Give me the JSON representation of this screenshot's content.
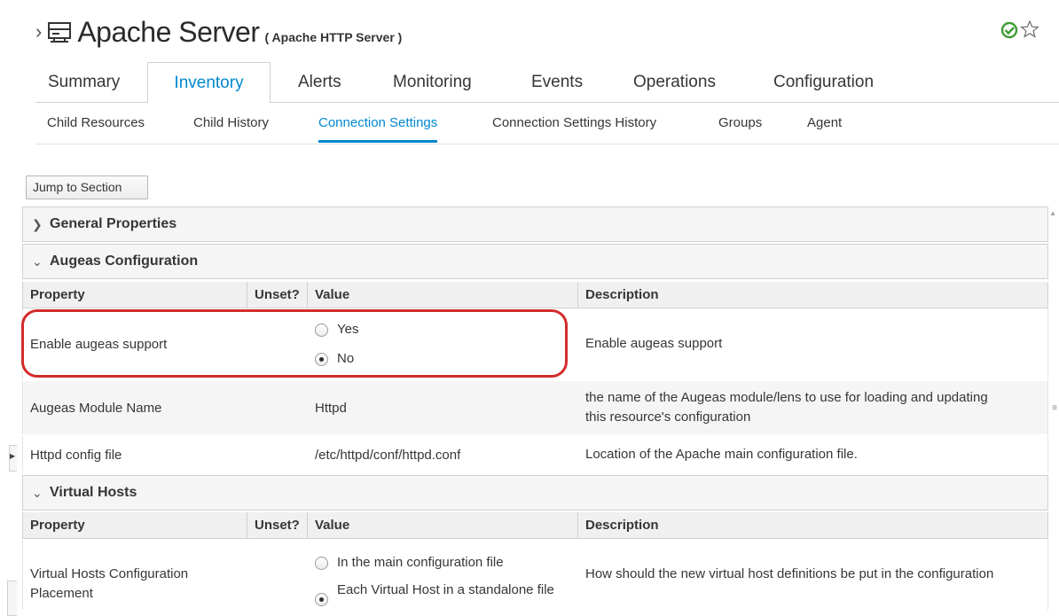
{
  "header": {
    "title": "Apache Server",
    "subtitle": "( Apache HTTP Server )",
    "chevron": "›",
    "status_color": "#3f9c35"
  },
  "tabs": [
    {
      "label": "Summary",
      "active": false
    },
    {
      "label": "Inventory",
      "active": true
    },
    {
      "label": "Alerts",
      "active": false
    },
    {
      "label": "Monitoring",
      "active": false
    },
    {
      "label": "Events",
      "active": false
    },
    {
      "label": "Operations",
      "active": false
    },
    {
      "label": "Configuration",
      "active": false
    }
  ],
  "subtabs": [
    {
      "label": "Child Resources",
      "active": false
    },
    {
      "label": "Child History",
      "active": false
    },
    {
      "label": "Connection Settings",
      "active": true
    },
    {
      "label": "Connection Settings History",
      "active": false
    },
    {
      "label": "Groups",
      "active": false
    },
    {
      "label": "Agent",
      "active": false
    }
  ],
  "jump_button": "Jump to Section",
  "grid_headers": {
    "property": "Property",
    "unset": "Unset?",
    "value": "Value",
    "description": "Description"
  },
  "sections": {
    "general": {
      "label": "General Properties",
      "expanded": false
    },
    "augeas": {
      "label": "Augeas Configuration",
      "expanded": true,
      "rows": [
        {
          "property": "Enable augeas support",
          "options": [
            "Yes",
            "No"
          ],
          "selected": "No",
          "description": "Enable augeas support"
        },
        {
          "property": "Augeas Module Name",
          "value": "Httpd",
          "description": "the name of the Augeas module/lens to use for loading and updating this resource's configuration"
        },
        {
          "property": "Httpd config file",
          "value": "/etc/httpd/conf/httpd.conf",
          "description": "Location of the Apache main configuration file."
        }
      ]
    },
    "virtual_hosts": {
      "label": "Virtual Hosts",
      "expanded": true,
      "rows": [
        {
          "property": "Virtual Hosts Configuration Placement",
          "options": [
            "In the main configuration file",
            "Each Virtual Host in a standalone file"
          ],
          "selected": "Each Virtual Host in a standalone file",
          "description": "How should the new virtual host definitions be put in the configuration"
        }
      ]
    }
  },
  "colors": {
    "accent": "#0088ce",
    "highlight": "#d42b2b"
  }
}
